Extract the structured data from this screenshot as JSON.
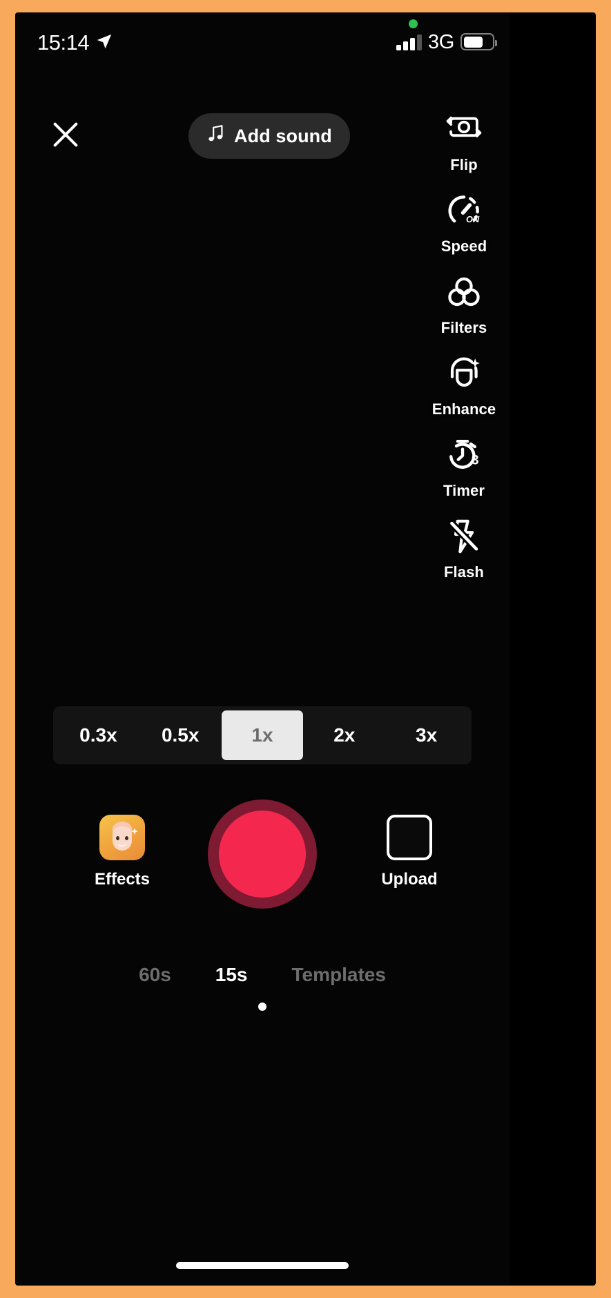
{
  "theme": {
    "frame_color": "#F9A95C",
    "screen_background": "#050505",
    "accent_record": "#F4284F",
    "accent_record_ring": "#7E1B33",
    "status_green": "#30C14E",
    "selected_chip_bg": "#E9E9E9",
    "selected_chip_text": "#6E6E6E",
    "inactive_text": "#6D6D6D"
  },
  "status_bar": {
    "clock": "15:14",
    "location_icon": "location-arrow-icon",
    "recording_dot_icon": "green-recording-dot-icon",
    "signal_icon": "cellular-signal-bars-icon",
    "signal_bars_filled": 3,
    "signal_bars_total": 4,
    "network": "3G",
    "battery_icon": "battery-icon",
    "battery_percent": 68
  },
  "top_bar": {
    "close_icon": "close-icon",
    "add_sound": {
      "label": "Add sound",
      "icon": "music-note-icon"
    }
  },
  "tool_rail": {
    "items": [
      {
        "label": "Flip",
        "icon": "camera-flip-icon"
      },
      {
        "label": "Speed",
        "icon": "speedometer-icon",
        "badge": "ON"
      },
      {
        "label": "Filters",
        "icon": "filters-circles-icon"
      },
      {
        "label": "Enhance",
        "icon": "face-enhance-sparkle-icon"
      },
      {
        "label": "Timer",
        "icon": "stopwatch-icon",
        "badge": "3"
      },
      {
        "label": "Flash",
        "icon": "flash-off-icon"
      }
    ]
  },
  "speed_selector": {
    "options": [
      {
        "label": "0.3x",
        "selected": false
      },
      {
        "label": "0.5x",
        "selected": false
      },
      {
        "label": "1x",
        "selected": true
      },
      {
        "label": "2x",
        "selected": false
      },
      {
        "label": "3x",
        "selected": false
      }
    ]
  },
  "capture_row": {
    "effects": {
      "label": "Effects",
      "icon": "effects-face-tile-icon",
      "glyph": "👩"
    },
    "record": {
      "icon": "record-button-icon"
    },
    "upload": {
      "label": "Upload",
      "icon": "upload-thumbnail-icon"
    }
  },
  "mode_tabs": {
    "items": [
      {
        "label": "60s",
        "active": false
      },
      {
        "label": "15s",
        "active": true
      },
      {
        "label": "Templates",
        "active": false
      }
    ]
  },
  "home_indicator": {
    "icon": "home-indicator-bar"
  }
}
